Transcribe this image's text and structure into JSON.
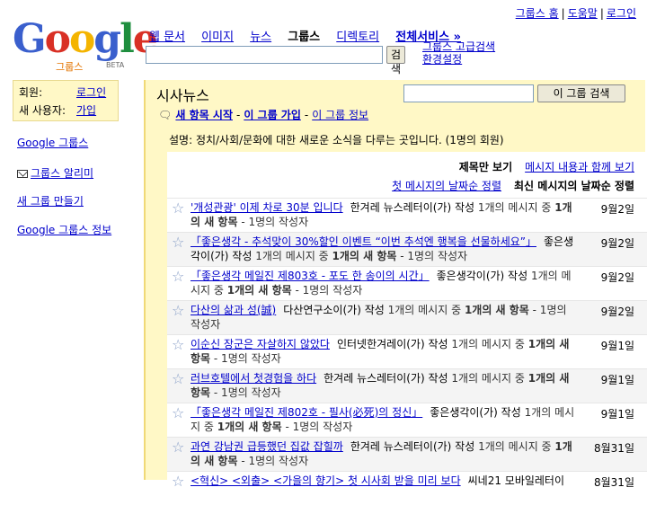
{
  "top_links": [
    "그룹스 홈",
    "도움말",
    "로그인"
  ],
  "logo": {
    "word_letters": [
      "G",
      "o",
      "o",
      "g",
      "l",
      "e"
    ],
    "letter_colors": [
      "#3a5fcd",
      "#d93025",
      "#f4b400",
      "#3a5fcd",
      "#1e8e3e",
      "#d93025"
    ],
    "sub": "그룹스",
    "beta": "BETA"
  },
  "nav": {
    "items": [
      "웹 문서",
      "이미지",
      "뉴스",
      "그룹스",
      "디렉토리"
    ],
    "current": "그룹스",
    "all_services": "전체서비스 »"
  },
  "search": {
    "button": "검색",
    "advanced": "그룹스 고급검색",
    "settings": "환경설정"
  },
  "account": {
    "member_label": "회원:",
    "login": "로그인",
    "new_user_label": "새 사용자:",
    "signup": "가입"
  },
  "sidebar": {
    "groups_link": "Google 그룹스",
    "alerts": "그룹스 알리미",
    "create": "새 그룹 만들기",
    "about": "Google 그룹스 정보"
  },
  "group": {
    "title": "시사뉴스",
    "search_button": "이 그룹 검색",
    "actions": [
      "새 항목 시작",
      "이 그룹 가입",
      "이 그룹 정보"
    ],
    "description": "설명: 정치/사회/문화에 대한 새로운 소식을 다루는 곳입니다. (1명의 회원)"
  },
  "view_options": {
    "subject_only": "제목만 보기",
    "with_content": "메시지 내용과 함께 보기"
  },
  "sort_options": {
    "first_message": "첫 메시지의 날짜순 정렬",
    "latest_message": "최신 메시지의 날짜순 정렬"
  },
  "threads": [
    {
      "subject": "'개성관광' 이제 차로 30분 입니다",
      "author": "한겨레 뉴스레터이(가) 작성",
      "meta": "1개의 메시지 중 1개의 새 항목 - 1명의 작성자",
      "date": "9월2일"
    },
    {
      "subject": "「좋은생각 - 추석맞이 30%할인 이벤트 “이번 추석엔 행복을 선물하세요”」",
      "author": "좋은생각이(가) 작성",
      "meta": "1개의 메시지 중 1개의 새 항목 - 1명의 작성자",
      "date": "9월2일"
    },
    {
      "subject": "「좋은생각 메일진 제803호 - 포도 한 송이의 시간」",
      "author": "좋은생각이(가) 작성",
      "meta": "1개의 메시지 중 1개의 새 항목 - 1명의 작성자",
      "date": "9월2일"
    },
    {
      "subject": "다산의 삶과 성(誠)",
      "author": "다산연구소이(가) 작성",
      "meta": "1개의 메시지 중 1개의 새 항목 - 1명의 작성자",
      "date": "9월2일"
    },
    {
      "subject": "이순신 장군은 자살하지 않았다",
      "author": "인터넷한겨레이(가) 작성",
      "meta": "1개의 메시지 중 1개의 새 항목 - 1명의 작성자",
      "date": "9월1일"
    },
    {
      "subject": "러브호텔에서 첫경험을 하다",
      "author": "한겨레 뉴스레터이(가) 작성",
      "meta": "1개의 메시지 중 1개의 새 항목 - 1명의 작성자",
      "date": "9월1일"
    },
    {
      "subject": "「좋은생각 메일진 제802호 - 필사(必死)의 정신」",
      "author": "좋은생각이(가) 작성",
      "meta": "1개의 메시지 중 1개의 새 항목 - 1명의 작성자",
      "date": "9월1일"
    },
    {
      "subject": "과연 강남권 급등했던 집값 잡힐까",
      "author": "한겨레 뉴스레터이(가) 작성",
      "meta": "1개의 메시지 중 1개의 새 항목 - 1명의 작성자",
      "date": "8월31일"
    },
    {
      "subject": "<혁신> <외출> <가을의 향기> 첫 시사회 받을 미리 보다",
      "author": "씨네21 모바일레터이",
      "meta": "",
      "date": "8월31일"
    }
  ]
}
